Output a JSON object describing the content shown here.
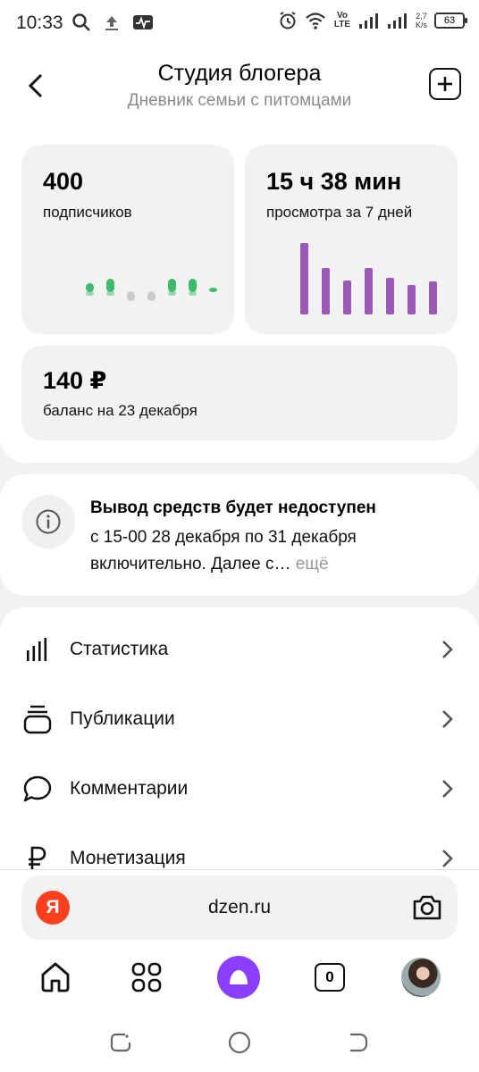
{
  "status_bar": {
    "time": "10:33",
    "speed_value": "2,7",
    "speed_unit": "K/s",
    "network": "Vo LTE",
    "battery": "63"
  },
  "header": {
    "title": "Студия блогера",
    "subtitle": "Дневник семьи с питомцами"
  },
  "stats": {
    "subscribers": {
      "value": "400",
      "label": "подписчиков"
    },
    "views": {
      "value": "15 ч 38 мин",
      "label": "просмотра за 7 дней"
    },
    "balance": {
      "value": "140 ₽",
      "label": "баланс на 23 декабря"
    }
  },
  "subscriber_chart": {
    "changes": [
      1,
      2,
      -1,
      -1,
      2,
      2,
      0
    ],
    "positive_color": "#3dbb6b",
    "negative_color": "#c9c9c9"
  },
  "views_chart": {
    "values": [
      80,
      52,
      38,
      52,
      41,
      33,
      37
    ],
    "color": "#9b59b6"
  },
  "notice": {
    "title": "Вывод средств будет недоступен",
    "body": "с 15-00 28 декабря по 31 декабря включительно. Далее с…",
    "more": "ещё"
  },
  "menu": [
    {
      "label": "Статистика",
      "icon": "bar-chart-icon"
    },
    {
      "label": "Публикации",
      "icon": "stack-icon"
    },
    {
      "label": "Комментарии",
      "icon": "comment-icon"
    },
    {
      "label": "Монетизация",
      "icon": "ruble-icon"
    }
  ],
  "browser": {
    "logo": "Я",
    "url": "dzen.ru",
    "tabs_count": "0"
  },
  "colors": {
    "accent": "#8b3ffd",
    "yandex": "#fc3f1d"
  }
}
